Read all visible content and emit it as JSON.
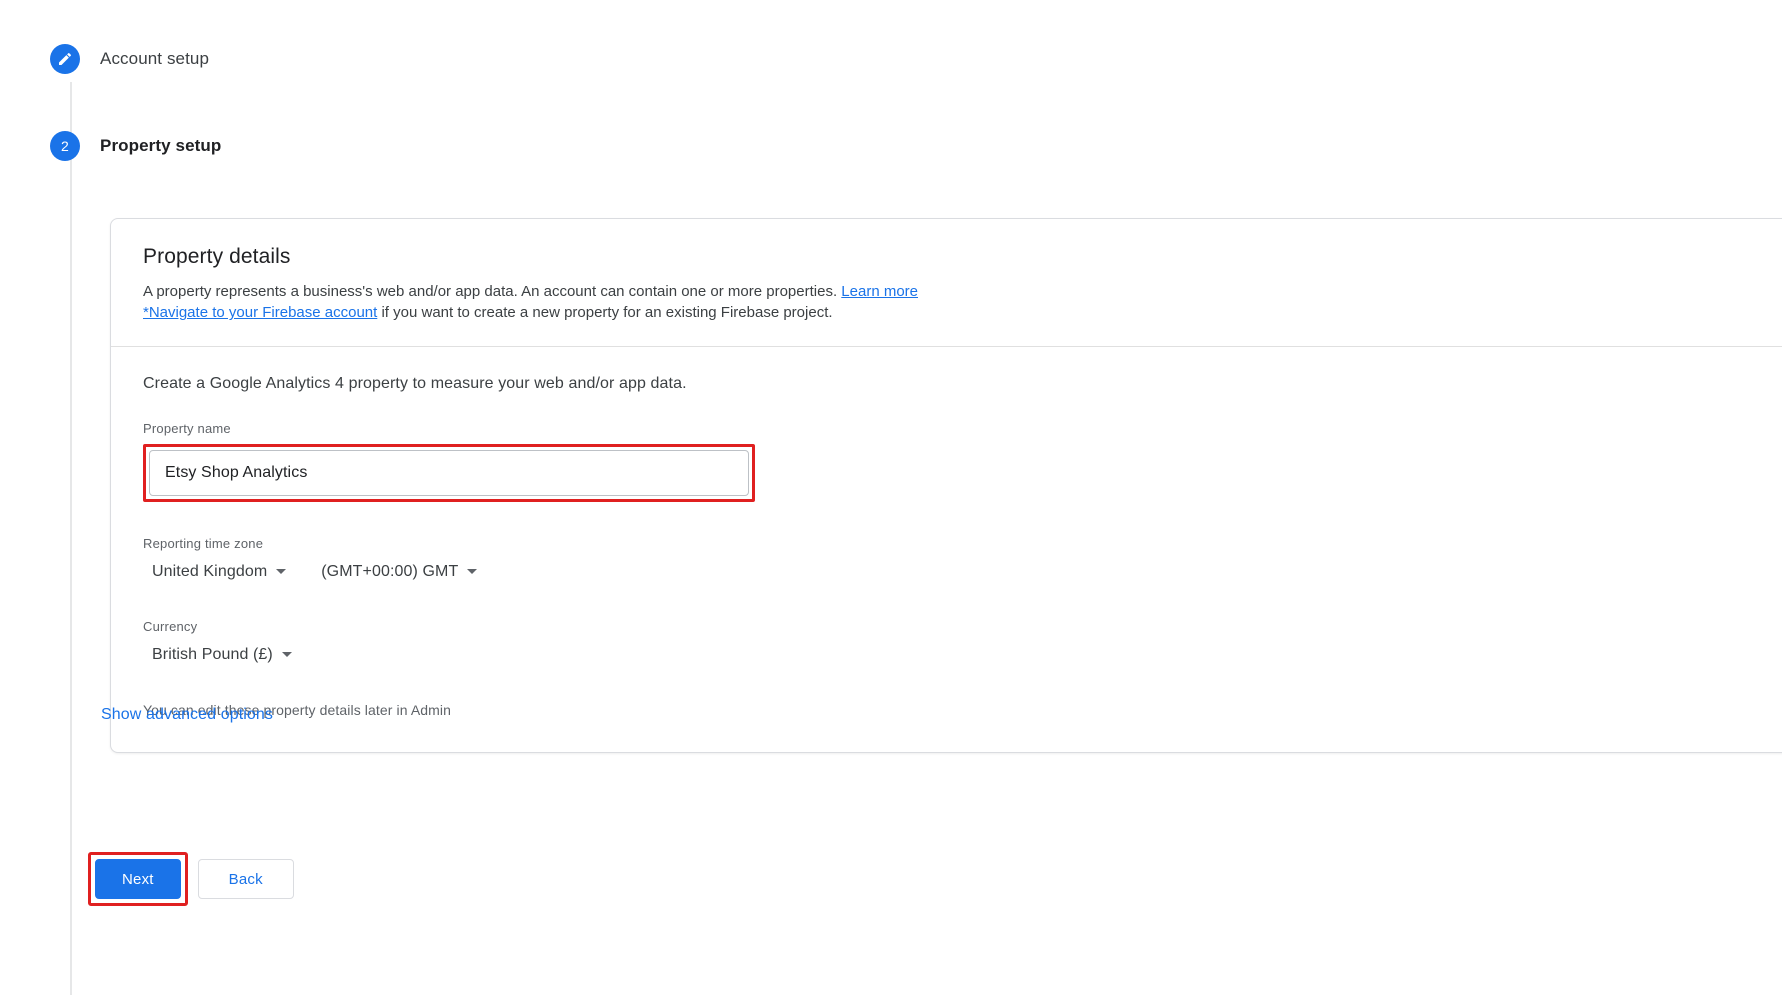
{
  "stepper": {
    "steps": [
      {
        "badge": "edit-icon",
        "label": "Account setup",
        "state": "completed"
      },
      {
        "badge": "2",
        "label": "Property setup",
        "state": "active"
      }
    ]
  },
  "card": {
    "title": "Property details",
    "description_part1": "A property represents a business's web and/or app data. An account can contain one or more properties. ",
    "learn_more_link": "Learn more",
    "firebase_link": "*Navigate to your Firebase account",
    "description_part2": " if you want to create a new property for an existing Firebase project.",
    "intro": "Create a Google Analytics 4 property to measure your web and/or app data.",
    "property_name": {
      "label": "Property name",
      "value": "Etsy Shop Analytics",
      "placeholder": "Property name"
    },
    "time_zone": {
      "label": "Reporting time zone",
      "country": "United Kingdom",
      "offset": "(GMT+00:00) GMT"
    },
    "currency": {
      "label": "Currency",
      "value": "British Pound (£)"
    },
    "note": "You can edit these property details later in Admin"
  },
  "advanced_options_link": "Show advanced options",
  "actions": {
    "next_label": "Next",
    "back_label": "Back"
  },
  "colors": {
    "accent_blue": "#1a73e8",
    "highlight_red": "#e02020",
    "text_primary": "#202124",
    "text_secondary": "#5f6368",
    "border": "#dadce0"
  }
}
